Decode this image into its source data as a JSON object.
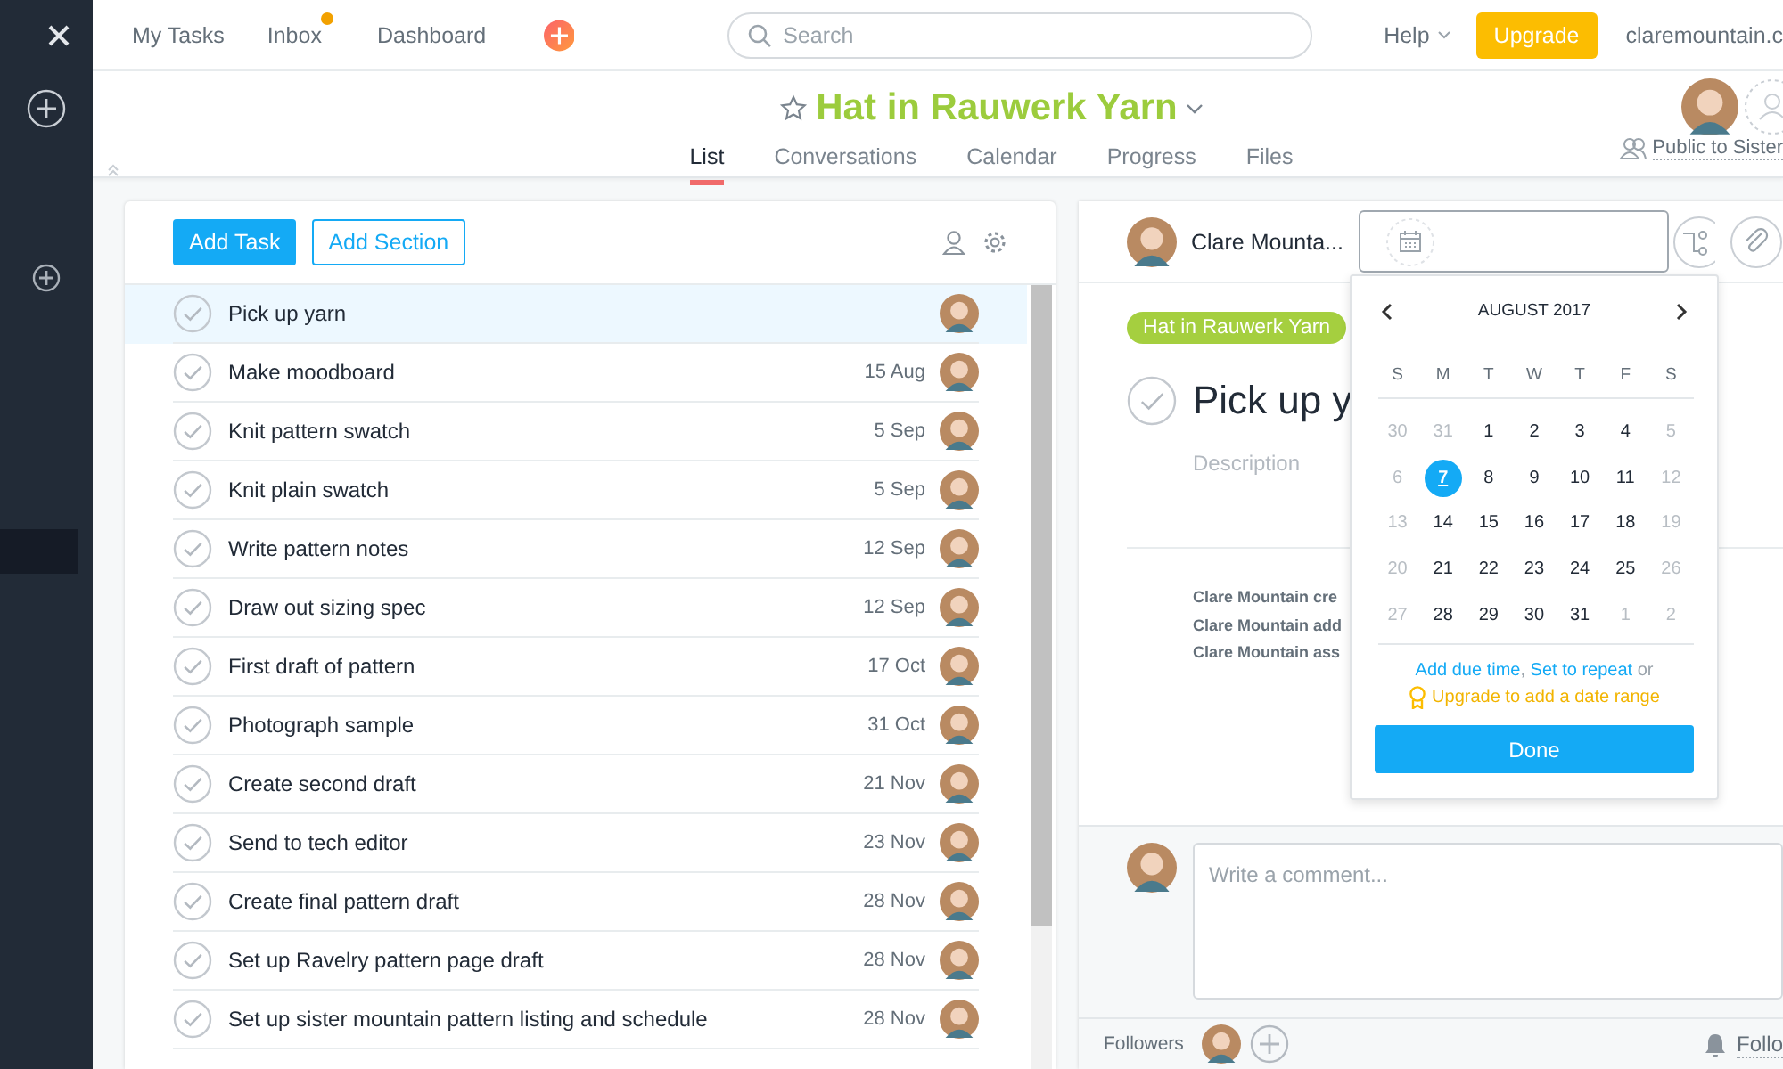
{
  "top_nav": {
    "items": [
      {
        "label": "My Tasks",
        "unread": false
      },
      {
        "label": "Inbox",
        "unread": true
      },
      {
        "label": "Dashboard",
        "unread": false
      }
    ],
    "search": {
      "placeholder": "Search"
    },
    "help": "Help",
    "upgrade": "Upgrade",
    "account": "claremountain.c"
  },
  "project": {
    "title": "Hat in Rauwerk Yarn",
    "starred": false,
    "tabs": [
      {
        "label": "List",
        "selected": true
      },
      {
        "label": "Conversations",
        "selected": false
      },
      {
        "label": "Calendar",
        "selected": false
      },
      {
        "label": "Progress",
        "selected": false
      },
      {
        "label": "Files",
        "selected": false
      }
    ],
    "privacy": "Public to Sister"
  },
  "task_list": {
    "add_task": "Add Task",
    "add_section": "Add Section",
    "tasks": [
      {
        "name": "Pick up yarn",
        "completed": false,
        "selected": true
      },
      {
        "name": "Make moodboard",
        "due": "15 Aug",
        "completed": false,
        "selected": false
      },
      {
        "name": "Knit pattern swatch",
        "due": "5 Sep",
        "completed": false,
        "selected": false
      },
      {
        "name": "Knit plain swatch",
        "due": "5 Sep",
        "completed": false,
        "selected": false
      },
      {
        "name": "Write pattern notes",
        "due": "12 Sep",
        "completed": false,
        "selected": false
      },
      {
        "name": "Draw out sizing spec",
        "due": "12 Sep",
        "completed": false,
        "selected": false
      },
      {
        "name": "First draft of pattern",
        "due": "17 Oct",
        "completed": false,
        "selected": false
      },
      {
        "name": "Photograph sample",
        "due": "31 Oct",
        "completed": false,
        "selected": false
      },
      {
        "name": "Create second draft",
        "due": "21 Nov",
        "completed": false,
        "selected": false
      },
      {
        "name": "Send to tech editor",
        "due": "23 Nov",
        "completed": false,
        "selected": false
      },
      {
        "name": "Create final pattern draft",
        "due": "28 Nov",
        "completed": false,
        "selected": false
      },
      {
        "name": "Set up Ravelry pattern page draft",
        "due": "28 Nov",
        "completed": false,
        "selected": false
      },
      {
        "name": "Set up sister mountain pattern listing and schedule",
        "due": "28 Nov",
        "completed": false,
        "selected": false
      }
    ]
  },
  "task_detail": {
    "assignee": "Clare Mounta...",
    "project_tag": "Hat in Rauwerk Yarn",
    "title": "Pick up y",
    "completed": false,
    "description_placeholder": "Description",
    "activity": [
      "Clare Mountain cre",
      "Clare Mountain add",
      "Clare Mountain ass"
    ],
    "comment_placeholder": "Write a comment...",
    "followers_label": "Followers",
    "follow": "Follo"
  },
  "date_picker": {
    "month": "AUGUST 2017",
    "weekdays": [
      "S",
      "M",
      "T",
      "W",
      "T",
      "F",
      "S"
    ],
    "weeks": [
      [
        {
          "day": "30",
          "in_month": false,
          "selected": false
        },
        {
          "day": "31",
          "in_month": false,
          "selected": false
        },
        {
          "day": "1",
          "in_month": true,
          "selected": false
        },
        {
          "day": "2",
          "in_month": true,
          "selected": false
        },
        {
          "day": "3",
          "in_month": true,
          "selected": false
        },
        {
          "day": "4",
          "in_month": true,
          "selected": false
        },
        {
          "day": "5",
          "in_month": false,
          "selected": false
        }
      ],
      [
        {
          "day": "6",
          "in_month": false,
          "selected": false
        },
        {
          "day": "7",
          "in_month": true,
          "selected": true
        },
        {
          "day": "8",
          "in_month": true,
          "selected": false
        },
        {
          "day": "9",
          "in_month": true,
          "selected": false
        },
        {
          "day": "10",
          "in_month": true,
          "selected": false
        },
        {
          "day": "11",
          "in_month": true,
          "selected": false
        },
        {
          "day": "12",
          "in_month": false,
          "selected": false
        }
      ],
      [
        {
          "day": "13",
          "in_month": false,
          "selected": false
        },
        {
          "day": "14",
          "in_month": true,
          "selected": false
        },
        {
          "day": "15",
          "in_month": true,
          "selected": false
        },
        {
          "day": "16",
          "in_month": true,
          "selected": false
        },
        {
          "day": "17",
          "in_month": true,
          "selected": false
        },
        {
          "day": "18",
          "in_month": true,
          "selected": false
        },
        {
          "day": "19",
          "in_month": false,
          "selected": false
        }
      ],
      [
        {
          "day": "20",
          "in_month": false,
          "selected": false
        },
        {
          "day": "21",
          "in_month": true,
          "selected": false
        },
        {
          "day": "22",
          "in_month": true,
          "selected": false
        },
        {
          "day": "23",
          "in_month": true,
          "selected": false
        },
        {
          "day": "24",
          "in_month": true,
          "selected": false
        },
        {
          "day": "25",
          "in_month": true,
          "selected": false
        },
        {
          "day": "26",
          "in_month": false,
          "selected": false
        }
      ],
      [
        {
          "day": "27",
          "in_month": false,
          "selected": false
        },
        {
          "day": "28",
          "in_month": true,
          "selected": false
        },
        {
          "day": "29",
          "in_month": true,
          "selected": false
        },
        {
          "day": "30",
          "in_month": true,
          "selected": false
        },
        {
          "day": "31",
          "in_month": true,
          "selected": false
        },
        {
          "day": "1",
          "in_month": false,
          "selected": false
        },
        {
          "day": "2",
          "in_month": false,
          "selected": false
        }
      ]
    ],
    "add_due_time": "Add due time",
    "separator": ",",
    "set_repeat": "Set to repeat",
    "conjunction": "or",
    "upgrade_link": "Upgrade to add a date range",
    "done": "Done"
  }
}
